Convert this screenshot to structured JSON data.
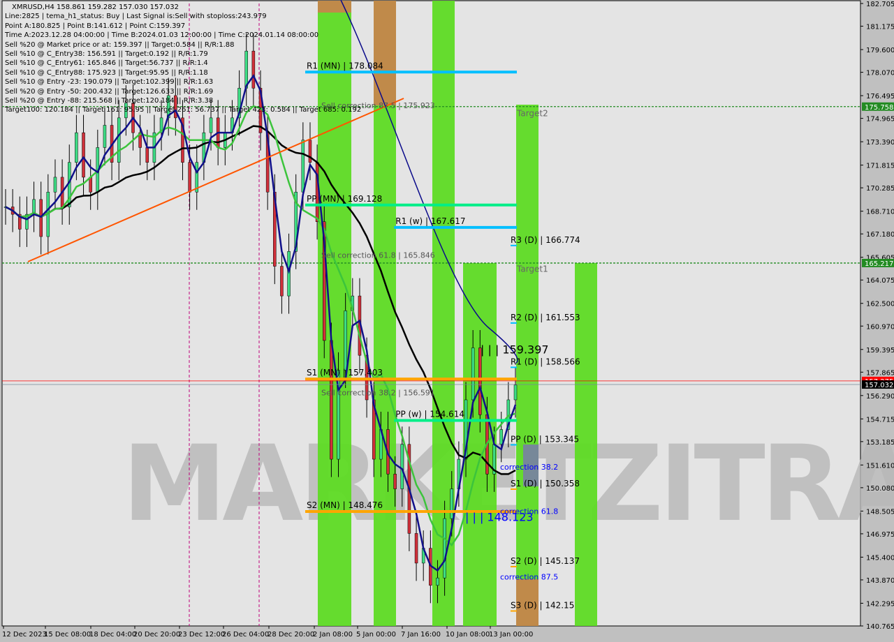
{
  "header": {
    "symbol": "XMRUSD,H4  158.861 159.282 157.030 157.032",
    "lines": [
      "Line:2825 | tema_h1_status: Buy | Last Signal is:Sell with stoploss:243.979",
      "Point A:180.825 | Point B:141.612 | Point C:159.397",
      "Time A:2023.12.28 04:00:00 | Time B:2024.01.03 12:00:00 | Time C:2024.01.14 08:00:00",
      "Sell %20 @ Market price or at: 159.397 || Target:0.584 || R/R:1.88",
      "Sell %10 @ C_Entry38: 156.591 || Target:0.192 || R/R:1.79",
      "Sell %10 @ C_Entry61: 165.846 || Target:56.737 || R/R:1.4",
      "Sell %10 @ C_Entry88: 175.923 || Target:95.95 || R/R:1.18",
      "Sell %10 @ Entry -23: 190.079 || Target:102.399 || R/R:1.63",
      "Sell %20 @ Entry -50: 200.432 || Target:126.633 || R/R:1.69",
      "Sell %20 @ Entry -88: 215.568 || Target:120.184 || R/R:3.38",
      "Target100: 120.184 || Target 161: 95.95 || Target 261: 56.737 || Target 423: 0.584 || Target 685: 0.192"
    ]
  },
  "chart_data": {
    "type": "candlestick",
    "ylim": [
      140.765,
      182.705
    ],
    "y_ticks": [
      "182.705",
      "181.175",
      "179.600",
      "178.070",
      "176.495",
      "174.965",
      "173.390",
      "171.815",
      "170.285",
      "168.710",
      "167.180",
      "165.605",
      "164.075",
      "162.500",
      "160.970",
      "159.395",
      "157.865",
      "156.290",
      "154.715",
      "153.185",
      "151.610",
      "150.080",
      "148.505",
      "146.975",
      "145.400",
      "143.870",
      "142.295",
      "140.765"
    ],
    "x_ticks": [
      "12 Dec 2023",
      "15 Dec 08:00",
      "18 Dec 04:00",
      "20 Dec 20:00",
      "23 Dec 12:00",
      "26 Dec 04:00",
      "28 Dec 20:00",
      "2 Jan 08:00",
      "5 Jan 00:00",
      "7 Jan 16:00",
      "10 Jan 08:00",
      "13 Jan 00:00"
    ],
    "closes": [
      169,
      168.5,
      167.5,
      168.5,
      169.5,
      167,
      170,
      171,
      169,
      172,
      174,
      171,
      170,
      173,
      174.5,
      172,
      175,
      176,
      174,
      173,
      172,
      174,
      175,
      176.5,
      175,
      172,
      170,
      172,
      174,
      175,
      173,
      174,
      175,
      177,
      179.5,
      177,
      174,
      170,
      165,
      163,
      166,
      170,
      173.5,
      172,
      168,
      160,
      152,
      158,
      162,
      163,
      159,
      156,
      152,
      154,
      151,
      150,
      153,
      147,
      145,
      146,
      143.5,
      144,
      148,
      150,
      152,
      156,
      159.5,
      155,
      151,
      153,
      154,
      156,
      157
    ],
    "current_price": {
      "label": "157.032",
      "value": 157.032,
      "color": "#000000"
    },
    "bid_label": {
      "label": "157.275",
      "value": 157.275,
      "color": "#ff0000"
    },
    "dashed_levels": [
      {
        "value": 175.758,
        "label": "175.758",
        "color": "#228b22"
      },
      {
        "value": 165.217,
        "label": "165.217",
        "color": "#228b22"
      }
    ],
    "levels": [
      {
        "name": "R1 (MN) | 178.084",
        "value": 178.084,
        "color": "#00bfff",
        "from": 0,
        "to": 1
      },
      {
        "name": "PP (MN) | 169.128",
        "value": 169.128,
        "color": "#00ee88",
        "from": 0,
        "to": 1
      },
      {
        "name": "R1 (w) | 167.617",
        "value": 167.617,
        "color": "#00bfff",
        "from": 0.42,
        "to": 1
      },
      {
        "name": "PP (w) | 154.614",
        "value": 154.614,
        "color": "#00ee88",
        "from": 0.42,
        "to": 1
      },
      {
        "name": "S1 (MN) | 157.403",
        "value": 157.403,
        "color": "#ffa500",
        "from": 0,
        "to": 1
      },
      {
        "name": "S2 (MN) | 148.476",
        "value": 148.476,
        "color": "#ffa500",
        "from": 0,
        "to": 1
      }
    ],
    "daily_levels": [
      {
        "name": "R3 (D) | 166.774",
        "value": 166.774
      },
      {
        "name": "R2 (D) | 161.553",
        "value": 161.553
      },
      {
        "name": "R1 (D) | 158.566",
        "value": 158.566
      },
      {
        "name": "PP (D) | 153.345",
        "value": 153.345
      },
      {
        "name": "S1 (D) | 150.358",
        "value": 150.358
      },
      {
        "name": "S2 (D) | 145.137",
        "value": 145.137
      },
      {
        "name": "S3 (D) | 142.15",
        "value": 142.15
      }
    ],
    "corrections": [
      {
        "name": "Sell correction 87.5 | 175.923",
        "value": 175.923
      },
      {
        "name": "Sell correction 61.8 | 165.846",
        "value": 165.846
      },
      {
        "name": "Sell correction 38.2 | 156.591",
        "value": 156.591
      }
    ],
    "blue_labels": [
      {
        "name": "correction 38.2",
        "value": 151.3
      },
      {
        "name": "correction 61.8",
        "value": 148.3
      },
      {
        "name": "correction 87.5",
        "value": 143.9
      }
    ],
    "point_labels": [
      {
        "name": "| | | 159.397",
        "value": 159.397,
        "color": "#000000"
      },
      {
        "name": "| | | 148.123",
        "value": 148.123,
        "color": "#0000ff"
      }
    ],
    "targets": [
      {
        "name": "Target2",
        "value": 175.4
      },
      {
        "name": "Target1",
        "value": 164.9
      }
    ],
    "watermark": "MARKETZITRADE",
    "colors": {
      "band_green": "#5edb24",
      "band_brown": "#c08a4a",
      "bull": "#3ddc84",
      "bear": "#d0303a",
      "ma_black": "#000000",
      "ma_green": "#3cc43c",
      "ma_navy": "#0a0a8a",
      "trend": "#ff5500"
    }
  }
}
